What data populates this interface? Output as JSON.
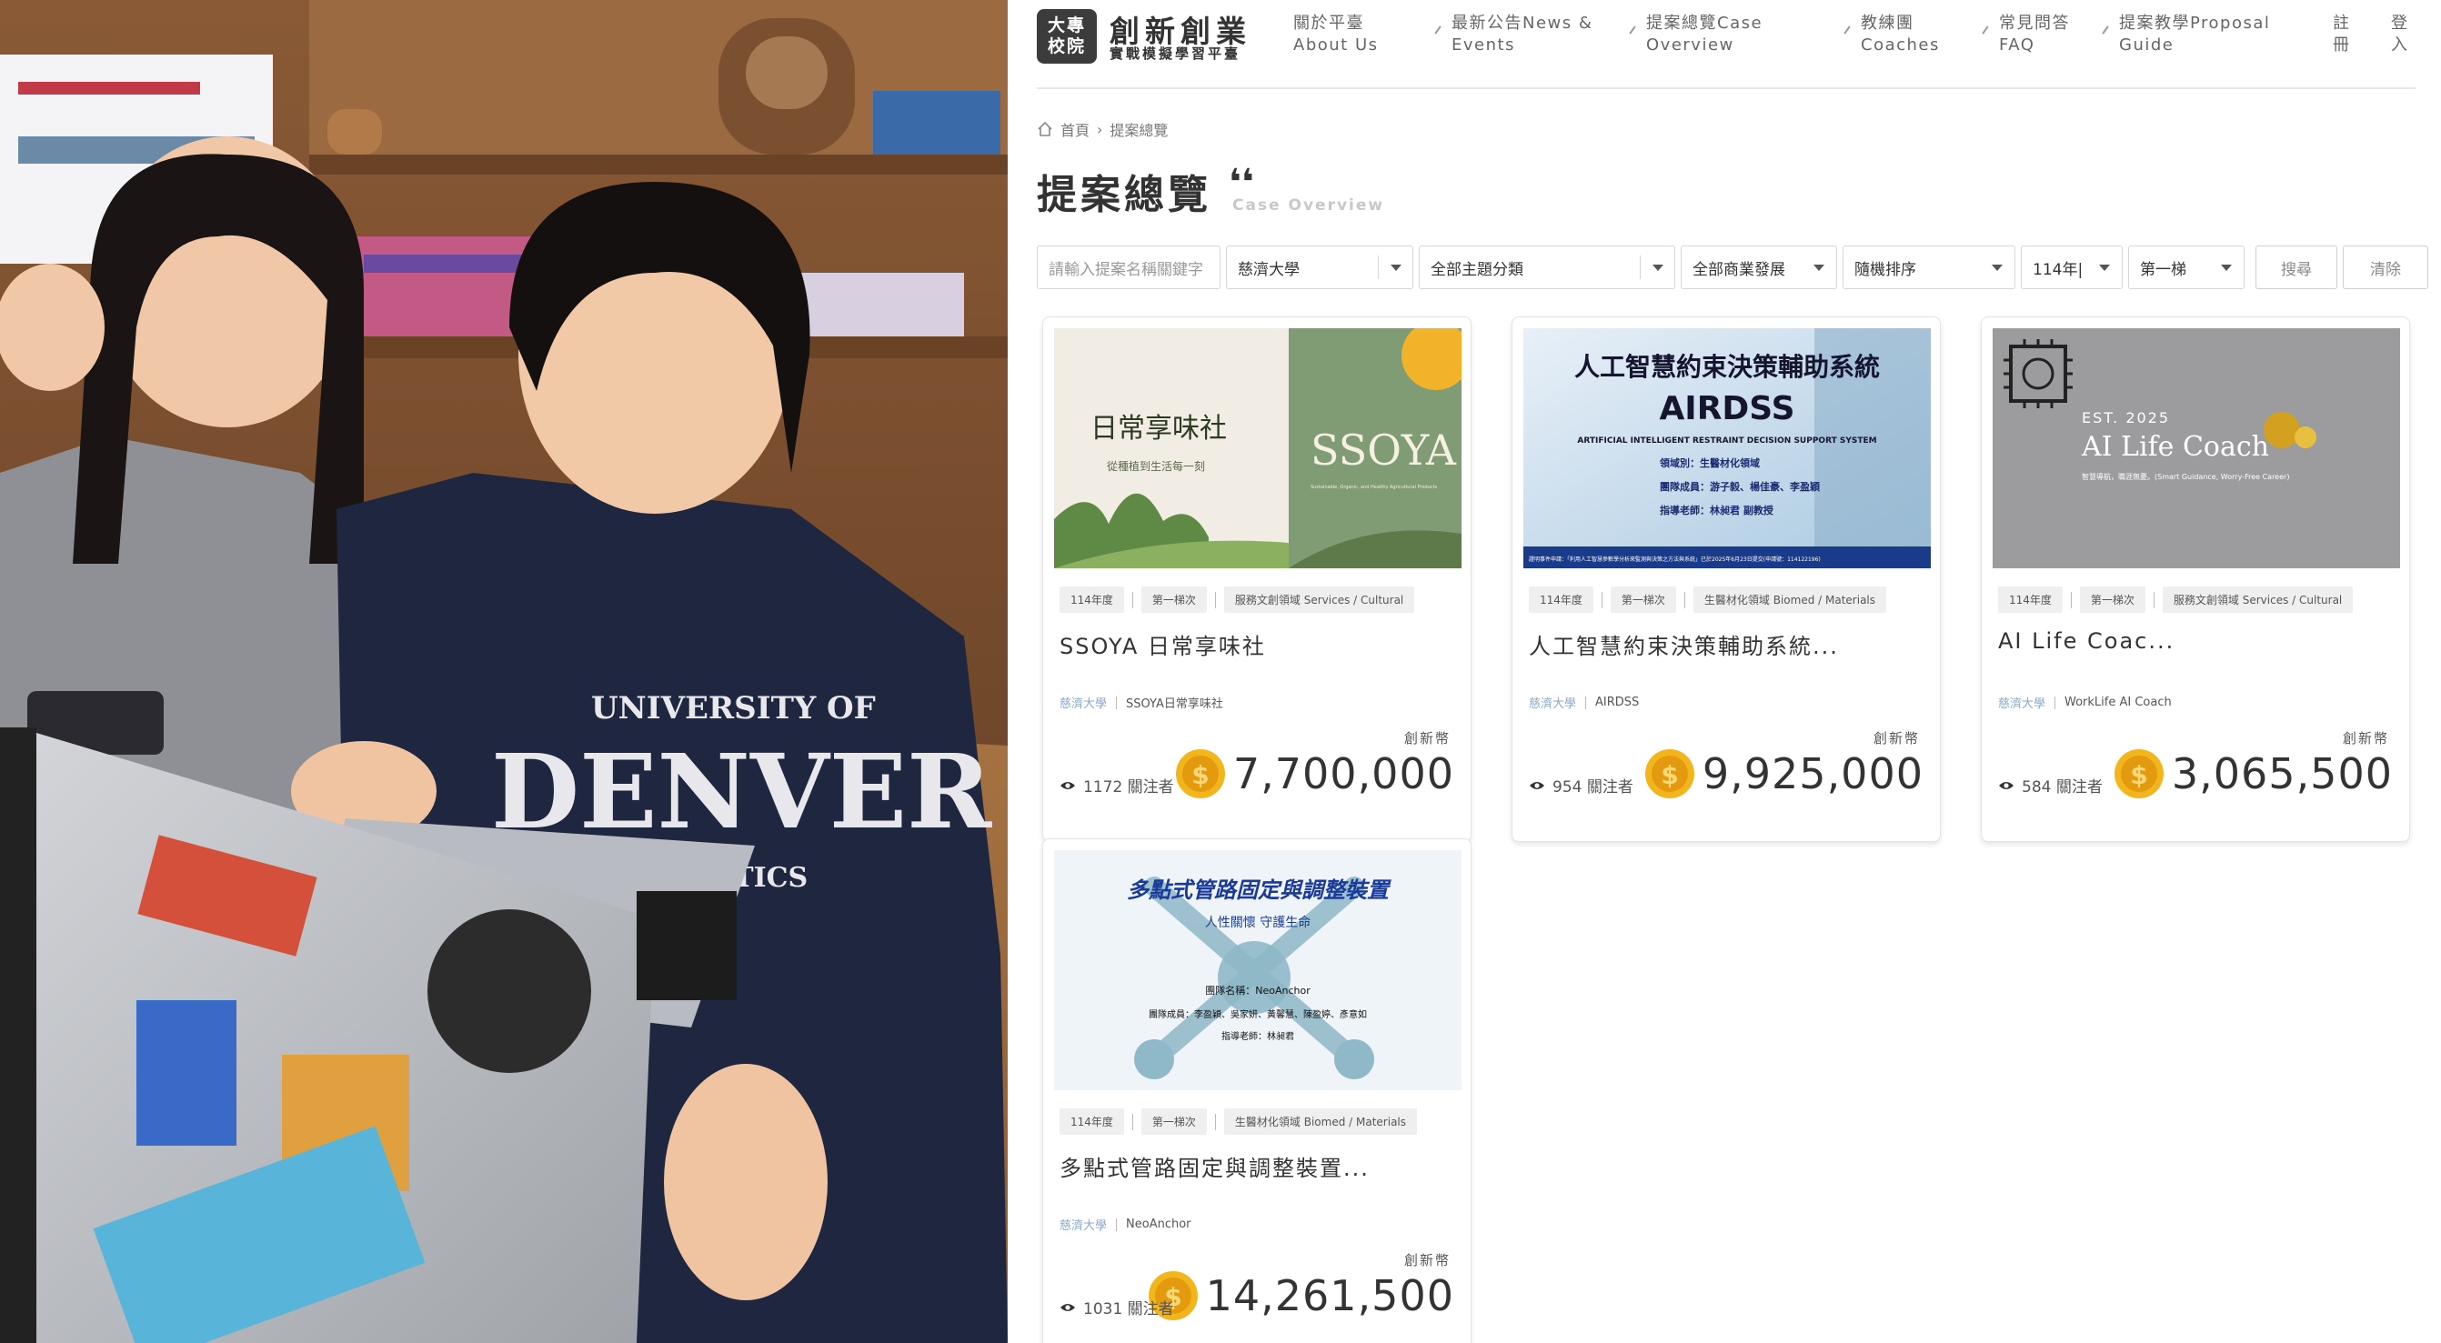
{
  "site": {
    "logo_badge": [
      "大專",
      "校院"
    ],
    "logo_title": "創新創業",
    "logo_subtitle": "實戰模擬學習平臺"
  },
  "nav": {
    "items": [
      {
        "zh": "關於平臺",
        "en": "About Us"
      },
      {
        "zh": "最新公告News &",
        "en": "Events"
      },
      {
        "zh": "提案總覽Case",
        "en": "Overview"
      },
      {
        "zh": "教練團",
        "en": "Coaches"
      },
      {
        "zh": "常見問答",
        "en": "FAQ"
      },
      {
        "zh": "提案教學Proposal",
        "en": "Guide"
      }
    ],
    "register": "註\n冊",
    "login": "登\n入"
  },
  "breadcrumb": {
    "home": "首頁",
    "current": "提案總覽",
    "separator": "›"
  },
  "page": {
    "title": "提案總覽",
    "quote": "❛❛",
    "subtitle": "Case Overview"
  },
  "filters": {
    "keyword_placeholder": "請輸入提案名稱關鍵字",
    "school": "慈濟大學",
    "theme": "全部主題分類",
    "business": "全部商業發展",
    "sort": "隨機排序",
    "year": "114年|",
    "tier": "第一梯",
    "search_label": "搜尋",
    "clear_label": "清除"
  },
  "coin_label": "創新幣",
  "cards": [
    {
      "tags": [
        "114年度",
        "第一梯次",
        "服務文創領域 Services / Cultural"
      ],
      "title": "SSOYA 日常享味社",
      "school": "慈濟大學",
      "team": "SSOYA日常享味社",
      "amount": "7,700,000",
      "followers": "1172 關注者",
      "thumb": {
        "left_text": "日常享味社",
        "left_sub": "從種植到生活每一刻",
        "brand": "SSOYA",
        "brand_sub": "Sustainable, Organic, and Healthy Agricultural Products"
      }
    },
    {
      "tags": [
        "114年度",
        "第一梯次",
        "生醫材化領域 Biomed / Materials"
      ],
      "title": "人工智慧約束決策輔助系統...",
      "school": "慈濟大學",
      "team": "AIRDSS",
      "amount": "9,925,000",
      "followers": "954 關注者",
      "thumb": {
        "heading": "人工智慧約束決策輔助系統",
        "acronym": "AIRDSS",
        "english": "ARTIFICIAL INTELLIGENT RESTRAINT DECISION SUPPORT SYSTEM",
        "field": "領域別：生醫材化領域",
        "members": "團隊成員：游子毅、楊佳豪、李盈穎",
        "advisor": "指導老師：林昶君 副教授",
        "footer": "證明事件申請：「利用人工智慧參數學分析來監測與決策之方法與系統」已於2025年6月23日提交(申請號：114122196)"
      }
    },
    {
      "tags": [
        "114年度",
        "第一梯次",
        "服務文創領域 Services / Cultural"
      ],
      "title": "AI Life Coac...",
      "school": "慈濟大學",
      "team": "WorkLife AI Coach",
      "amount": "3,065,500",
      "followers": "584 關注者",
      "thumb": {
        "est": "EST. 2025",
        "name": "AI Life Coach",
        "tagline": "智慧導航，職涯無憂。(Smart Guidance, Worry-Free Career)"
      }
    },
    {
      "tags": [
        "114年度",
        "第一梯次",
        "生醫材化領域 Biomed / Materials"
      ],
      "title": "多點式管路固定與調整裝置...",
      "school": "慈濟大學",
      "team": "NeoAnchor",
      "amount": "14,261,500",
      "followers": "1031 關注者",
      "thumb": {
        "heading": "多點式管路固定與調整裝置",
        "slogan": "人性關懷 守護生命",
        "team_name": "團隊名稱：NeoAnchor",
        "members": "團隊成員：李盈穎、吳家妍、黃馨慧、陳盈婷、彥意如",
        "advisor": "指導老師：林昶君"
      }
    }
  ],
  "photo": {
    "shirt_text": "UNIVERSITY OF",
    "shirt_big": "DENVER",
    "shirt_small": "ATHLETICS"
  },
  "colors": {
    "coin": "#f2b61c",
    "school_link": "#8aa8c8",
    "logo_bg": "#3c3c3c"
  }
}
